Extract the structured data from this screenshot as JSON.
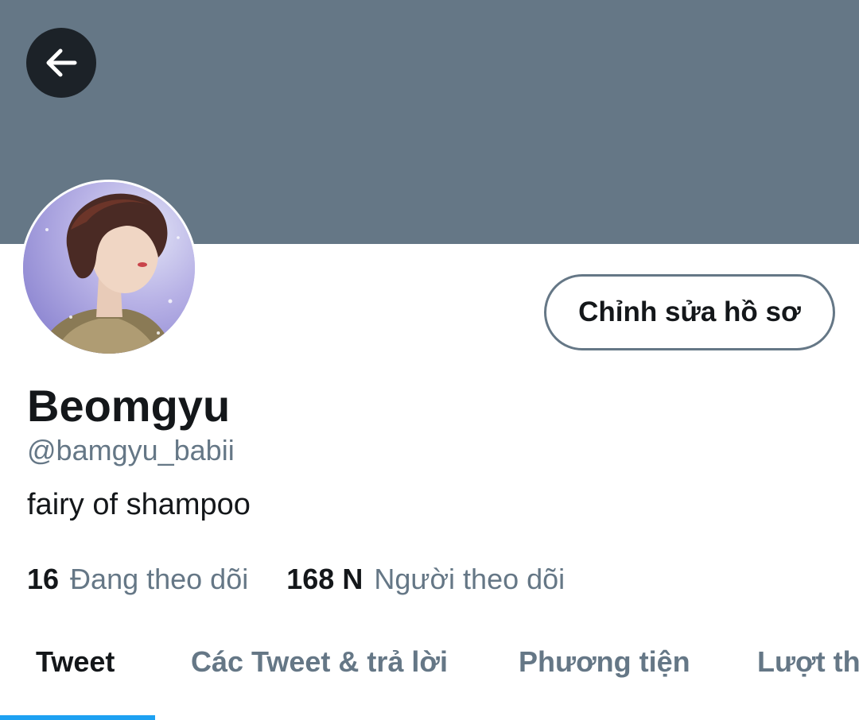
{
  "header": {
    "banner_color": "#657786",
    "back_icon": "arrow-left-icon"
  },
  "profile": {
    "avatar": "profile-photo",
    "edit_button_label": "Chỉnh sửa hồ sơ",
    "display_name": "Beomgyu",
    "handle": "@bamgyu_babii",
    "bio": "fairy of shampoo",
    "following_count": "16",
    "following_label": "Đang theo dõi",
    "followers_count": "168 N",
    "followers_label": "Người theo dõi"
  },
  "tabs": [
    {
      "label": "Tweet",
      "active": true
    },
    {
      "label": "Các Tweet & trả lời",
      "active": false
    },
    {
      "label": "Phương tiện",
      "active": false
    },
    {
      "label": "Lượt thích",
      "active": false
    }
  ],
  "colors": {
    "accent": "#1da1f2",
    "text_primary": "#14171a",
    "text_secondary": "#657786"
  }
}
